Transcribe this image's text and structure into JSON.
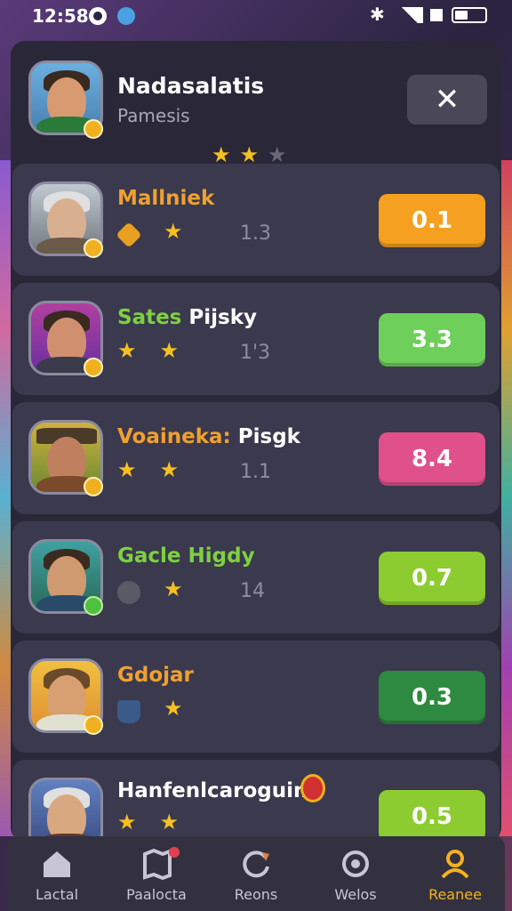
{
  "status_bar": {
    "time": "12:58"
  },
  "header": {
    "name": "Nadasalatis",
    "subtitle": "Pamesis",
    "close_label": "✕",
    "stars": 2,
    "stars_total": 3
  },
  "players": [
    {
      "name": "Mallniek",
      "name_rest": "",
      "name_color": "#f0a030",
      "number": "1.3",
      "score": "0.1",
      "score_color": "#f5a020",
      "item1": "gem",
      "item1_color": "#e8a020"
    },
    {
      "name": "Sates",
      "name_rest": " Pijsky",
      "name_color": "#7ed040",
      "number": "1'3",
      "score": "3.3",
      "score_color": "#6ecf5a",
      "item1": "star",
      "item1_color": "#f5c020"
    },
    {
      "name": "Voaineka:",
      "name_rest": " Pisgk",
      "name_color": "#f0a030",
      "number": "1.1",
      "score": "8.4",
      "score_color": "#e0508a",
      "item1": "star",
      "item1_color": "#f5c020"
    },
    {
      "name": "Gacle Higdy",
      "name_rest": "",
      "name_color": "#7ed040",
      "number": "14",
      "score": "0.7",
      "score_color": "#8ccc30",
      "item1": "bag",
      "item1_color": "#5a5a66"
    },
    {
      "name": "Gdojar",
      "name_rest": "",
      "name_color": "#f0a030",
      "number": "",
      "score": "0.3",
      "score_color": "#2e8a40",
      "item1": "pot",
      "item1_color": "#3a5a8a"
    },
    {
      "name": "Hanfenlcaroguim",
      "name_rest": "",
      "name_color": "#ffffff",
      "number": "",
      "score": "0.5",
      "score_color": "#8ccc30",
      "item1": "star",
      "item1_color": "#f5c020"
    }
  ],
  "nav": [
    {
      "label": "Lactal",
      "icon": "home-icon"
    },
    {
      "label": "Paalocta",
      "icon": "map-icon"
    },
    {
      "label": "Reons",
      "icon": "refresh-icon"
    },
    {
      "label": "Welos",
      "icon": "settings-icon"
    },
    {
      "label": "Reanee",
      "icon": "profile-icon",
      "active": true
    }
  ],
  "colors": {
    "panel": "#2a2838",
    "card": "#3b394d",
    "accent": "#f5b020"
  }
}
